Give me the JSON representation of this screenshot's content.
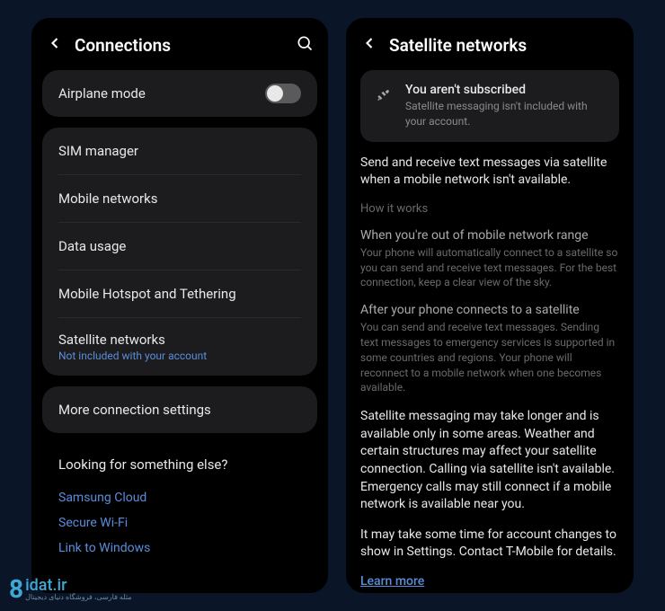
{
  "left": {
    "title": "Connections",
    "airplane": "Airplane mode",
    "airplane_on": false,
    "items": [
      {
        "label": "SIM manager"
      },
      {
        "label": "Mobile networks"
      },
      {
        "label": "Data usage"
      },
      {
        "label": "Mobile Hotspot and Tethering"
      },
      {
        "label": "Satellite networks",
        "sublabel": "Not included with your account"
      }
    ],
    "more": "More connection settings",
    "else_title": "Looking for something else?",
    "else_links": [
      "Samsung Cloud",
      "Secure Wi-Fi",
      "Link to Windows"
    ]
  },
  "right": {
    "title": "Satellite networks",
    "notice_title": "You aren't subscribed",
    "notice_sub": "Satellite messaging isn't included with your account.",
    "intro": "Send and receive text messages via satellite when a mobile network isn't available.",
    "how_it_works": "How it works",
    "sec1_title": "When you're out of mobile network range",
    "sec1_body": "Your phone will automatically connect to a satellite so you can send and receive text messages. For the best connection, keep a clear view of the sky.",
    "sec2_title": "After your phone connects to a satellite",
    "sec2_body": "You can send and receive text messages. Sending text messages to emergency services is supported in some countries and regions. Your phone will reconnect to a mobile network when one becomes available.",
    "para3": "Satellite messaging may take longer and is available only in some areas. Weather and certain structures may affect your satellite connection. Calling via satellite isn't available. Emergency calls may still connect if a mobile network is available near you.",
    "para4": "It may take some time for account changes to show in Settings. Contact T-Mobile for details.",
    "learn_more": "Learn more"
  },
  "watermark": {
    "logo": "8",
    "main": "idat.ir",
    "sub": "مثله فارسی، فروشگاه دنیای دیجیتال"
  }
}
